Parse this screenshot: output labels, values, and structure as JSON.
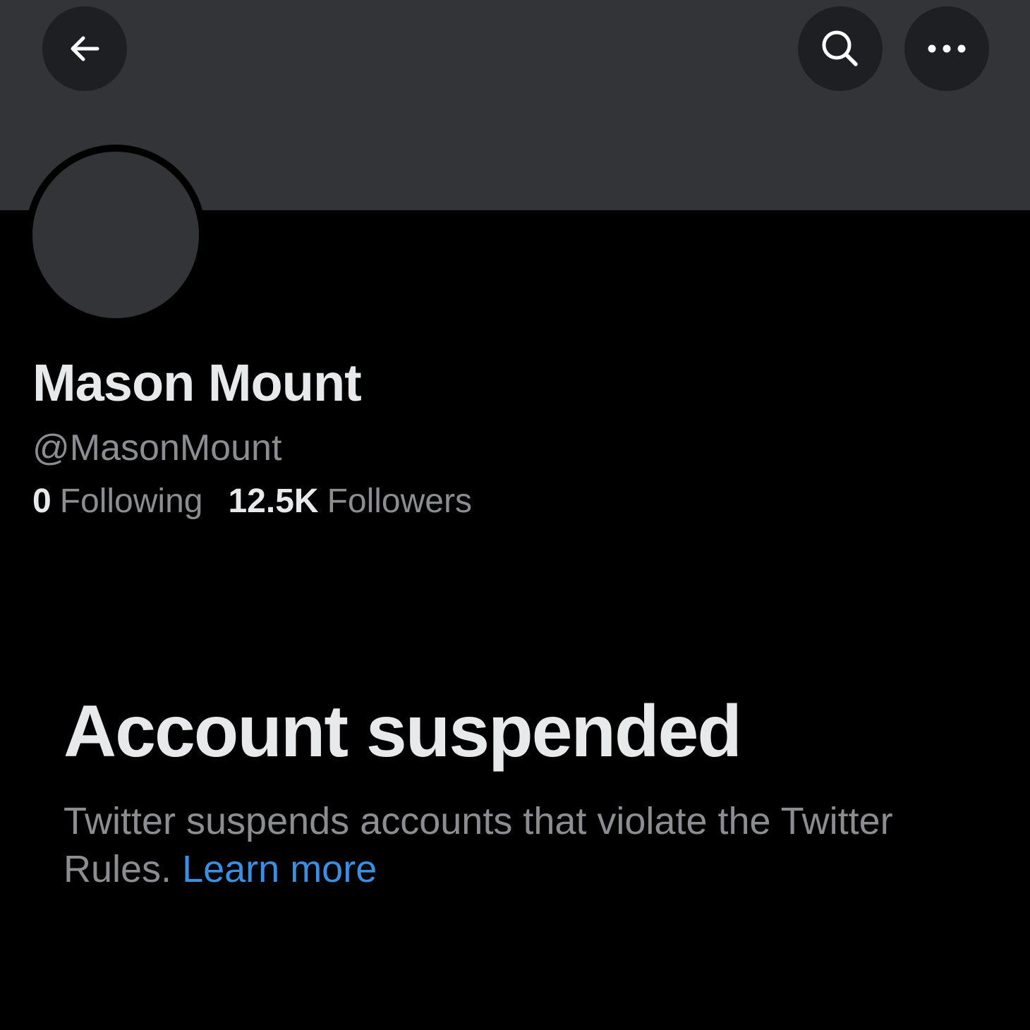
{
  "header": {
    "back_icon": "arrow-left-icon",
    "search_icon": "search-icon",
    "more_icon": "more-horizontal-icon"
  },
  "profile": {
    "display_name": "Mason Mount",
    "handle": "@MasonMount",
    "following_count": "0",
    "following_label": "Following",
    "followers_count": "12.5K",
    "followers_label": "Followers"
  },
  "suspension": {
    "title": "Account suspended",
    "message": "Twitter suspends accounts that violate the Twitter Rules.",
    "link_label": "Learn more"
  },
  "colors": {
    "background": "#000000",
    "banner": "#333438",
    "button_bg": "#1e1f22",
    "primary_text": "#e7e9ea",
    "secondary_text": "#8b8d91",
    "link": "#3a8fe3"
  }
}
